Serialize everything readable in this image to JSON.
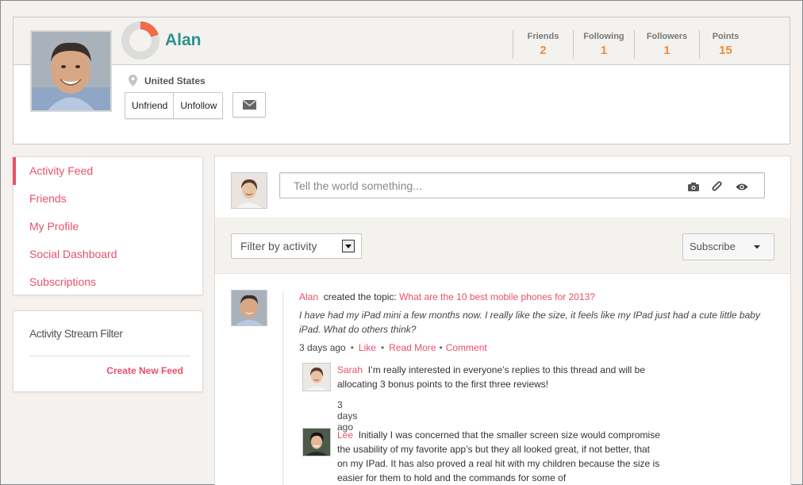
{
  "profile": {
    "name": "Alan",
    "location": "United States",
    "actions": {
      "unfriend": "Unfriend",
      "unfollow": "Unfollow"
    },
    "stats": [
      {
        "label": "Friends",
        "value": "2"
      },
      {
        "label": "Following",
        "value": "1"
      },
      {
        "label": "Followers",
        "value": "1"
      },
      {
        "label": "Points",
        "value": "15"
      }
    ],
    "progress_ring_fraction": 0.2
  },
  "sidebar": {
    "items": [
      {
        "label": "Activity Feed",
        "active": true
      },
      {
        "label": "Friends"
      },
      {
        "label": "My Profile"
      },
      {
        "label": "Social Dashboard"
      },
      {
        "label": "Subscriptions"
      }
    ]
  },
  "stream_filter": {
    "title": "Activity Stream Filter",
    "create_link": "Create New Feed"
  },
  "composer": {
    "placeholder": "Tell the world something...",
    "icons": [
      "camera-icon",
      "paperclip-icon",
      "eye-icon"
    ]
  },
  "feed_controls": {
    "filter_label": "Filter by activity",
    "subscribe_label": "Subscribe"
  },
  "post": {
    "author": "Alan",
    "action": "created the topic:",
    "topic": "What are the 10 best mobile phones for 2013?",
    "body": "I have had my iPad mini a few months now. I really like the size, it feels like my IPad just had a cute little baby iPad. What do others think?",
    "time": "3 days ago",
    "like": "Like",
    "read_more": "Read More",
    "comment": "Comment"
  },
  "replies": [
    {
      "author": "Sarah",
      "text": "I’m really interested in everyone’s replies to this thread and will be allocating 3 bonus points to the first three reviews!",
      "time": "3 days ago"
    },
    {
      "author": "Lee",
      "text": "Initially I was concerned that the smaller screen size would compromise the usability of my favorite app’s but they all looked great, if not better, that on my IPad. It has also proved a real hit with my children because the size is easier for them to hold and the commands for some of"
    }
  ],
  "colors": {
    "accent_pink": "#e8506a",
    "name_teal": "#2e9190",
    "stat_orange": "#f08c3c",
    "ring_orange": "#f26a4b"
  }
}
